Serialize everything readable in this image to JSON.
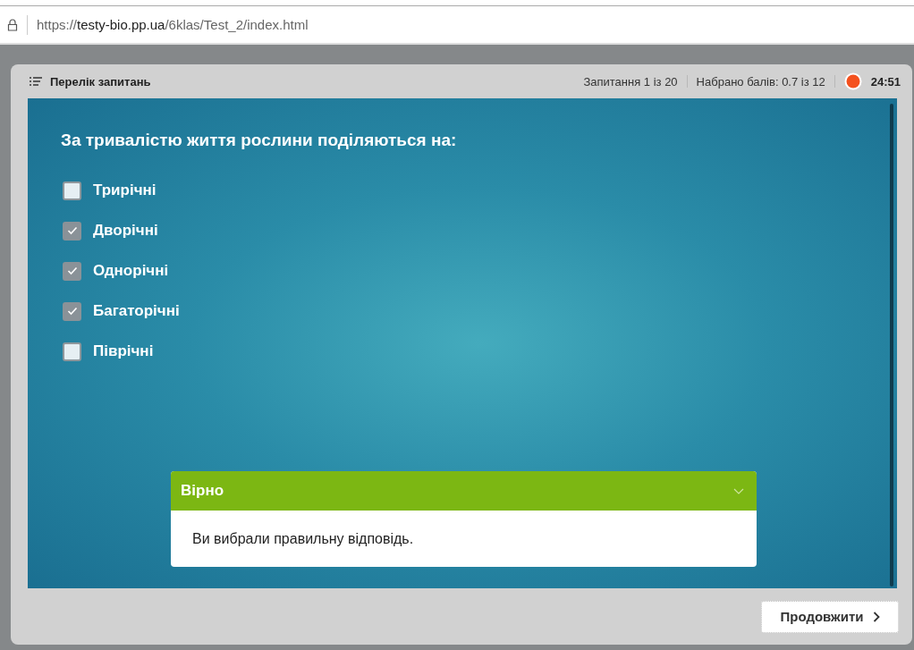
{
  "browser": {
    "url": "https://**testy-bio.pp.ua**/6klas/Test_2/index.html"
  },
  "player": {
    "menu_label": "Перелік запитань",
    "question_counter": "Запитання 1 із 20",
    "score": "Набрано балів: 0.7 із 12",
    "timer": "24:51"
  },
  "question": {
    "text": "За тривалістю життя рослини поділяються на:",
    "answers": [
      {
        "label": "Трирічні",
        "checked": false
      },
      {
        "label": "Дворічні",
        "checked": true
      },
      {
        "label": "Однорічні",
        "checked": true
      },
      {
        "label": "Багаторічні",
        "checked": true
      },
      {
        "label": "Піврічні",
        "checked": false
      }
    ]
  },
  "feedback": {
    "kind": "correct",
    "title": "Вірно",
    "message": "Ви вибрали правильну відповідь."
  },
  "buttons": {
    "continue": "Продовжити"
  }
}
